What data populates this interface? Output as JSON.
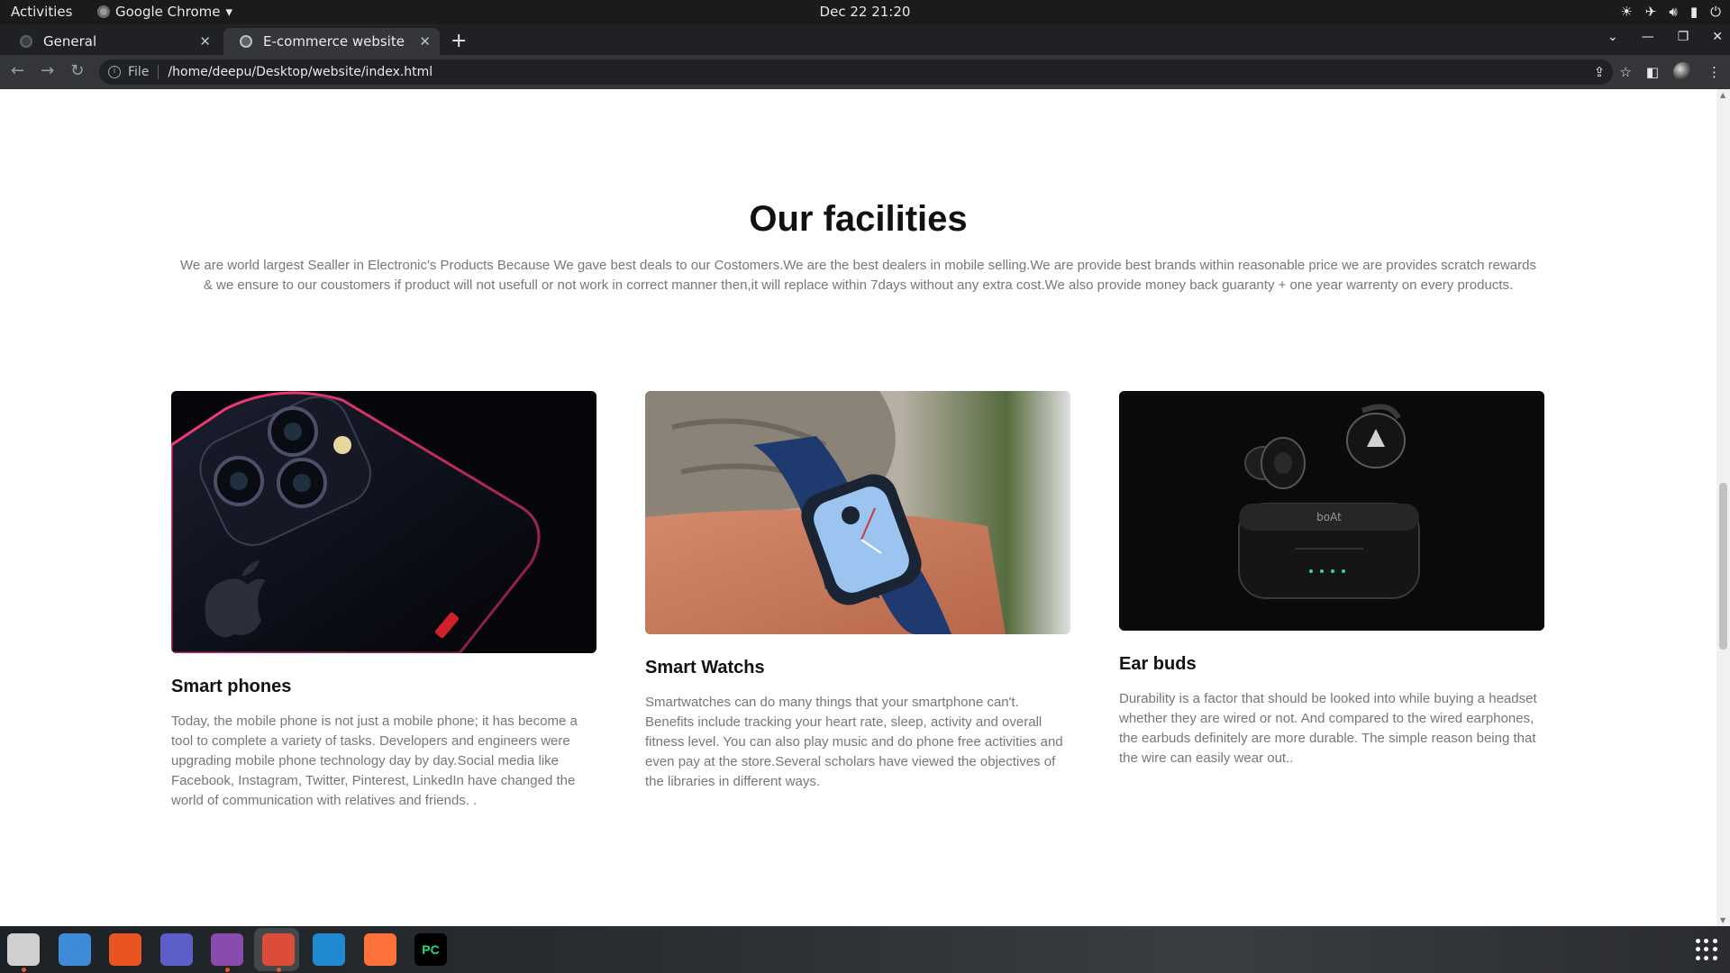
{
  "system": {
    "activities": "Activities",
    "app_menu": "Google Chrome",
    "clock": "Dec 22  21:20"
  },
  "browser": {
    "tabs": [
      {
        "label": "General"
      },
      {
        "label": "E-commerce website"
      }
    ],
    "omnibox": {
      "scheme": "File",
      "url": "/home/deepu/Desktop/website/index.html"
    }
  },
  "page": {
    "title": "Our facilities",
    "description": "We are world largest Sealler in Electronic's Products Because We gave best deals to our Costomers.We are the best dealers in mobile selling.We are provide best brands within reasonable price we are provides scratch rewards & we ensure to our coustomers if product will not usefull or not work in correct manner then,it will replace within 7days without any extra cost.We also provide money back guaranty + one year warrenty on every products.",
    "cards": [
      {
        "title": "Smart phones",
        "text": "Today, the mobile phone is not just a mobile phone; it has become a tool to complete a variety of tasks. Developers and engineers were upgrading mobile phone technology day by day.Social media like Facebook, Instagram, Twitter, Pinterest, LinkedIn have changed the world of communication with relatives and friends. ."
      },
      {
        "title": "Smart Watchs",
        "text": "Smartwatches can do many things that your smartphone can't. Benefits include tracking your heart rate, sleep, activity and overall fitness level. You can also play music and do phone free activities and even pay at the store.Several scholars have viewed the objectives of the libraries in different ways."
      },
      {
        "title": "Ear buds",
        "text": "Durability is a factor that should be looked into while buying a headset whether they are wired or not. And compared to the wired earphones, the earbuds definitely are more durable. The simple reason being that the wire can easily wear out..",
        "brand_on_case": "boAt"
      }
    ]
  },
  "dock": {
    "apps": [
      {
        "name": "files-icon",
        "color": "#cfcfcf"
      },
      {
        "name": "text-editor-icon",
        "color": "#3d8bd9"
      },
      {
        "name": "software-center-icon",
        "color": "#e95420"
      },
      {
        "name": "teams-icon",
        "color": "#5b5fc7"
      },
      {
        "name": "github-desktop-icon",
        "color": "#8a4baf"
      },
      {
        "name": "chrome-icon",
        "color": "#dd4b39"
      },
      {
        "name": "vscode-icon",
        "color": "#1f8ad2"
      },
      {
        "name": "firefox-icon",
        "color": "#ff7139"
      },
      {
        "name": "pycharm-icon",
        "color": "#21d789",
        "label": "PC"
      }
    ]
  }
}
